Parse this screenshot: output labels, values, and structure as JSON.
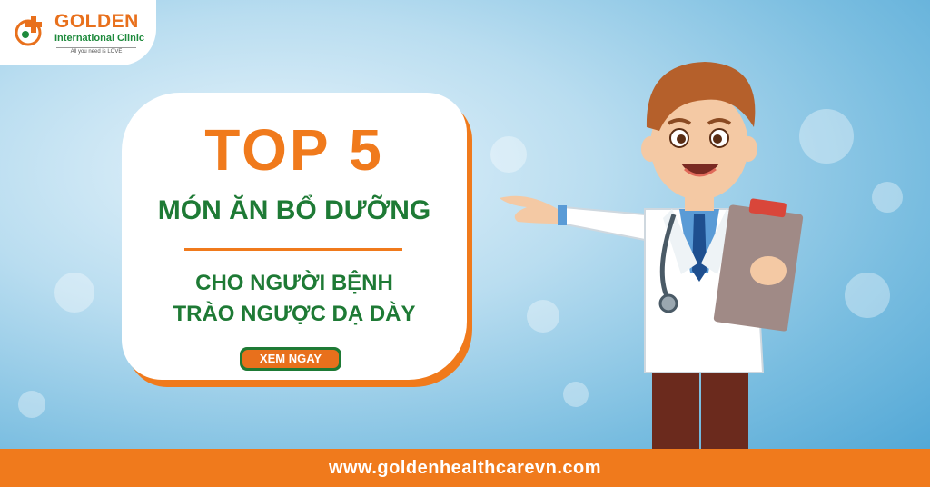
{
  "brand": {
    "name": "GOLDEN",
    "subtitle": "International Clinic",
    "slogan": "All you need is LOVE"
  },
  "headline": {
    "top": "TOP 5",
    "dish": "MÓN ĂN BỔ DƯỠNG",
    "line1": "CHO NGƯỜI BỆNH",
    "line2": "TRÀO NGƯỢC DẠ DÀY"
  },
  "cta": {
    "label": "XEM NGAY"
  },
  "footer": {
    "url": "www.goldenhealthcarevn.com"
  },
  "icons": {
    "logo": "medical-cross-logo-icon",
    "illustration": "doctor-with-clipboard-icon"
  },
  "colors": {
    "orange": "#f07a1c",
    "green": "#1e7a35",
    "sky": "#79bde0"
  }
}
